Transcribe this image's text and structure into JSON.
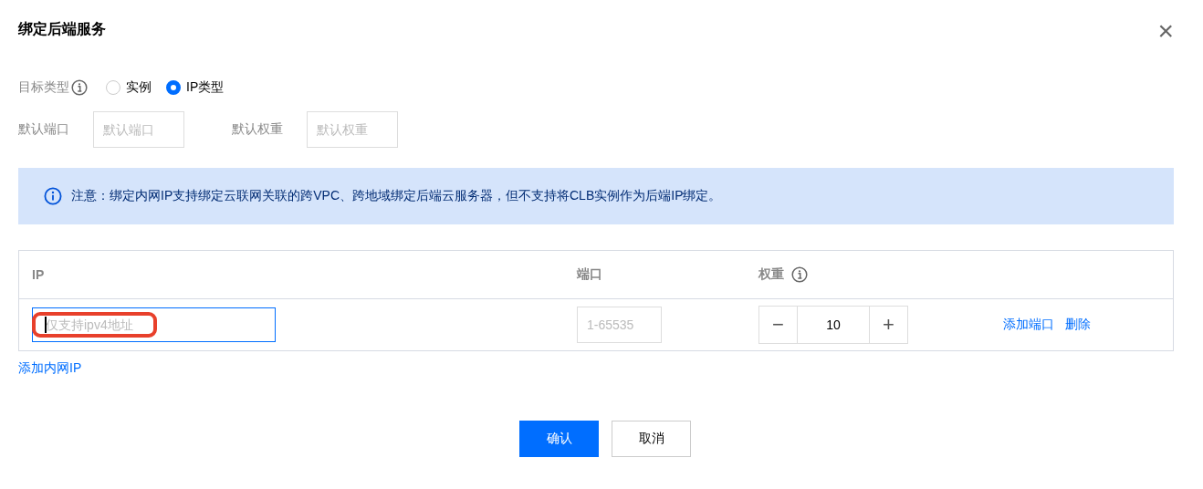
{
  "dialog": {
    "title": "绑定后端服务",
    "close": "×"
  },
  "target_type": {
    "label": "目标类型",
    "options": [
      {
        "label": "实例",
        "selected": false
      },
      {
        "label": "IP类型",
        "selected": true
      }
    ]
  },
  "defaults": [
    {
      "label": "默认端口",
      "placeholder": "默认端口"
    },
    {
      "label": "默认权重",
      "placeholder": "默认权重"
    }
  ],
  "notice": "注意：绑定内网IP支持绑定云联网关联的跨VPC、跨地域绑定后端云服务器，但不支持将CLB实例作为后端IP绑定。",
  "table": {
    "columns": [
      {
        "label": "IP",
        "kind": "text"
      },
      {
        "label": "端口",
        "kind": "text"
      },
      {
        "label": "权重",
        "kind": "info"
      }
    ],
    "rows": [
      {
        "ip_placeholder": "仅支持ipv4地址",
        "ip_focused": true,
        "ip_highlighted": true,
        "port_placeholder": "1-65535",
        "minus": "−",
        "weight": "10",
        "plus": "+",
        "actions": [
          "添加端口",
          "删除"
        ]
      }
    ]
  },
  "add_link": "添加内网IP",
  "buttons": [
    {
      "label": "确认",
      "kind": "primary"
    },
    {
      "label": "取消",
      "kind": "default"
    }
  ]
}
